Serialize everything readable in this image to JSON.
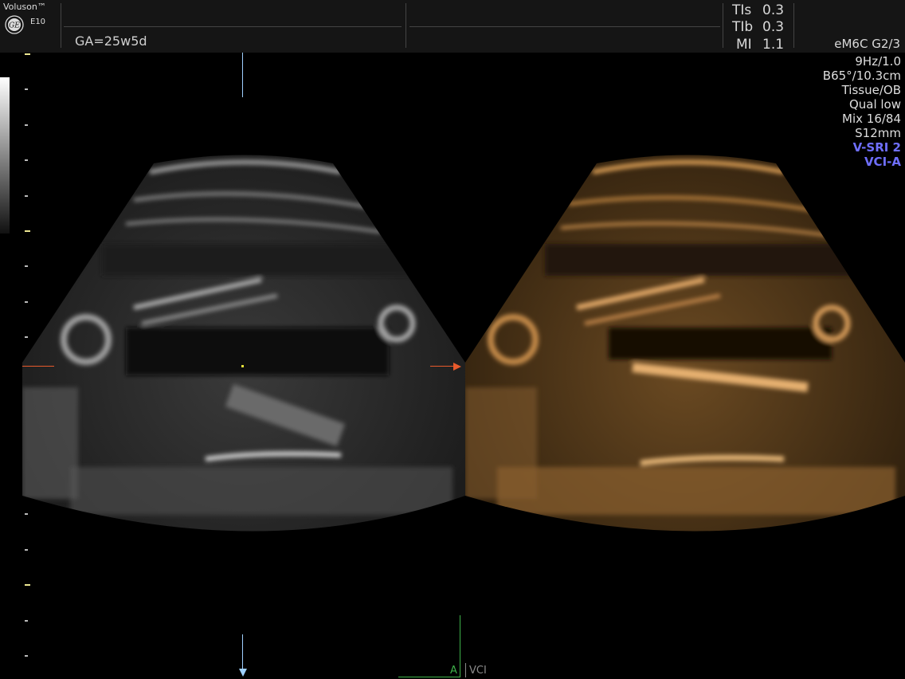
{
  "header": {
    "brand": "Voluson™",
    "model": "E10",
    "gestational_age": "GA=25w5d",
    "tis_label": "TIs",
    "tis_value": "0.3",
    "tib_label": "TIb",
    "tib_value": "0.3",
    "mi_label": "MI",
    "mi_value": "1.1",
    "probe": "eM6C G2/3"
  },
  "params": [
    {
      "text": "9Hz/1.0",
      "color": "#dedede"
    },
    {
      "text": "B65°/10.3cm",
      "color": "#dedede"
    },
    {
      "text": "Tissue/OB",
      "color": "#dedede"
    },
    {
      "text": "Qual low",
      "color": "#dedede"
    },
    {
      "text": "Mix 16/84",
      "color": "#dedede"
    },
    {
      "text": "S12mm",
      "color": "#dedede"
    },
    {
      "text": "V-SRI 2",
      "color": "#6f6fff"
    },
    {
      "text": "VCI-A",
      "color": "#6f6fff"
    }
  ],
  "footer": {
    "plane": "A",
    "mode": "VCI"
  },
  "colors": {
    "background": "#000000",
    "header_bg": "#151515",
    "render_tint": "#c8893c",
    "indicator_orange": "#e85a2c",
    "indicator_blue": "#9fd0ff",
    "plane_green": "#3fb24a"
  }
}
